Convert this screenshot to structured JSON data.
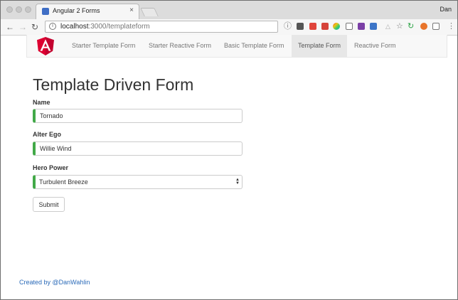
{
  "browser": {
    "tab_title": "Angular 2 Forms",
    "tab_close_glyph": "×",
    "profile_name": "Dan",
    "url_host": "localhost",
    "url_path": ":3000/templateform"
  },
  "navbar": {
    "items": [
      {
        "label": "Starter Template Form",
        "active": false
      },
      {
        "label": "Starter Reactive Form",
        "active": false
      },
      {
        "label": "Basic Template Form",
        "active": false
      },
      {
        "label": "Template Form",
        "active": true
      },
      {
        "label": "Reactive Form",
        "active": false
      }
    ]
  },
  "form": {
    "title": "Template Driven Form",
    "name_label": "Name",
    "name_value": "Tornado",
    "alter_ego_label": "Alter Ego",
    "alter_ego_value": "Willie Wind",
    "power_label": "Hero Power",
    "power_value": "Turbulent Breeze",
    "submit_label": "Submit"
  },
  "footer": {
    "credit": "Created by @DanWahlin"
  },
  "colors": {
    "valid_border": "#42a948",
    "link": "#2a6ab8",
    "angular_red": "#dd0031",
    "angular_dark_red": "#c3002f"
  }
}
